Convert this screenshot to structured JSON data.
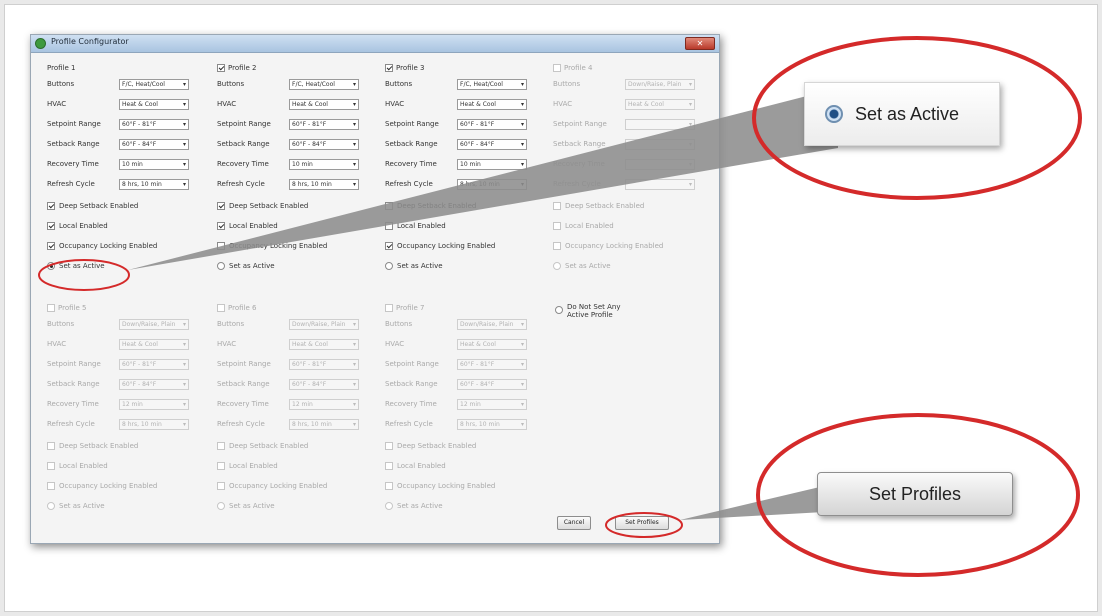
{
  "window": {
    "title": "Profile Configurator",
    "close": "✕"
  },
  "labels": {
    "buttons": "Buttons",
    "hvac": "HVAC",
    "setpoint": "Setpoint Range",
    "setback": "Setback Range",
    "recovery": "Recovery Time",
    "refresh": "Refresh Cycle"
  },
  "options": {
    "deep": "Deep Setback Enabled",
    "local": "Local Enabled",
    "occupancy": "Occupancy Locking Enabled",
    "active": "Set as Active"
  },
  "profiles": [
    {
      "title": "Profile 1",
      "enabled": true,
      "checked": false,
      "show_cb": false,
      "buttons": "F/C, Heat/Cool",
      "hvac": "Heat & Cool",
      "setpoint": "60°F - 81°F",
      "setback": "60°F - 84°F",
      "recovery": "10 min",
      "refresh": "8 hrs, 10 min",
      "deep": true,
      "local": true,
      "occupancy": true,
      "active": true
    },
    {
      "title": "Profile 2",
      "enabled": true,
      "checked": true,
      "show_cb": true,
      "buttons": "F/C, Heat/Cool",
      "hvac": "Heat & Cool",
      "setpoint": "60°F - 81°F",
      "setback": "60°F - 84°F",
      "recovery": "10 min",
      "refresh": "8 hrs, 10 min",
      "deep": true,
      "local": true,
      "occupancy": false,
      "active": false
    },
    {
      "title": "Profile 3",
      "enabled": true,
      "checked": true,
      "show_cb": true,
      "buttons": "F/C, Heat/Cool",
      "hvac": "Heat & Cool",
      "setpoint": "60°F - 81°F",
      "setback": "60°F - 84°F",
      "recovery": "10 min",
      "refresh": "8 hrs, 10 min",
      "deep": false,
      "local": false,
      "occupancy": true,
      "active": false
    },
    {
      "title": "Profile 4",
      "enabled": false,
      "checked": false,
      "show_cb": true,
      "buttons": "Down/Raise, Plain",
      "hvac": "Heat & Cool",
      "setpoint": "",
      "setback": "",
      "recovery": "",
      "refresh": "",
      "deep": false,
      "local": false,
      "occupancy": false,
      "active": false
    },
    {
      "title": "Profile 5",
      "enabled": false,
      "checked": false,
      "show_cb": true,
      "buttons": "Down/Raise, Plain",
      "hvac": "Heat & Cool",
      "setpoint": "60°F - 81°F",
      "setback": "60°F - 84°F",
      "recovery": "12 min",
      "refresh": "8 hrs, 10 min",
      "deep": false,
      "local": false,
      "occupancy": false,
      "active": false
    },
    {
      "title": "Profile 6",
      "enabled": false,
      "checked": false,
      "show_cb": true,
      "buttons": "Down/Raise, Plain",
      "hvac": "Heat & Cool",
      "setpoint": "60°F - 81°F",
      "setback": "60°F - 84°F",
      "recovery": "12 min",
      "refresh": "8 hrs, 10 min",
      "deep": false,
      "local": false,
      "occupancy": false,
      "active": false
    },
    {
      "title": "Profile 7",
      "enabled": false,
      "checked": false,
      "show_cb": true,
      "buttons": "Down/Raise, Plain",
      "hvac": "Heat & Cool",
      "setpoint": "60°F - 81°F",
      "setback": "60°F - 84°F",
      "recovery": "12 min",
      "refresh": "8 hrs, 10 min",
      "deep": false,
      "local": false,
      "occupancy": false,
      "active": false
    }
  ],
  "no_active": "Do Not Set Any Active Profile",
  "buttons": {
    "cancel": "Cancel",
    "set_profiles": "Set Profiles"
  },
  "callouts": {
    "active": "Set as Active",
    "set_profiles": "Set Profiles"
  },
  "colors": {
    "highlight": "#d42a2a",
    "beam": "#8d8d8d",
    "radio_fill": "#1f4f86"
  }
}
